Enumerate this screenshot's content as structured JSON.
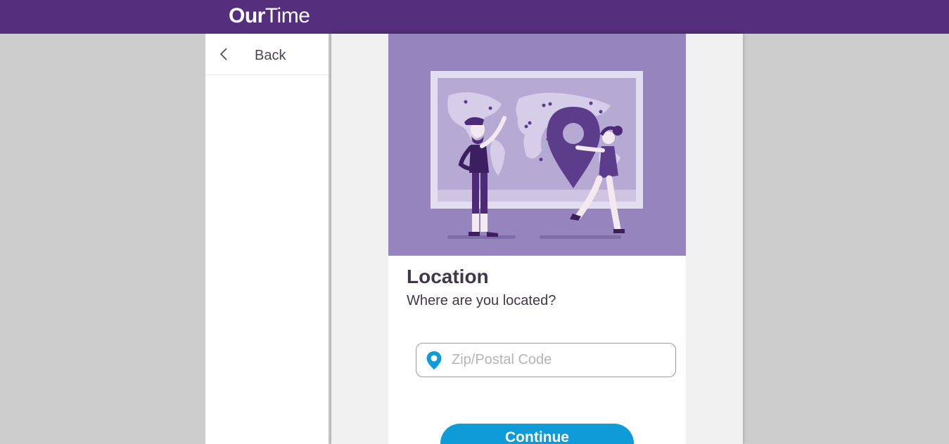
{
  "header": {
    "logo_bold": "Our",
    "logo_light": "Time",
    "bg_color": "#552f7d"
  },
  "sidebar": {
    "back_label": "Back",
    "back_icon": "chevron-left-icon"
  },
  "step": {
    "title": "Location",
    "subtitle": "Where are you located?",
    "zip_placeholder": "Zip/Postal Code",
    "zip_value": "",
    "zip_icon": "map-pin-icon",
    "continue_label": "Continue",
    "accent_color": "#0f9bd8"
  }
}
